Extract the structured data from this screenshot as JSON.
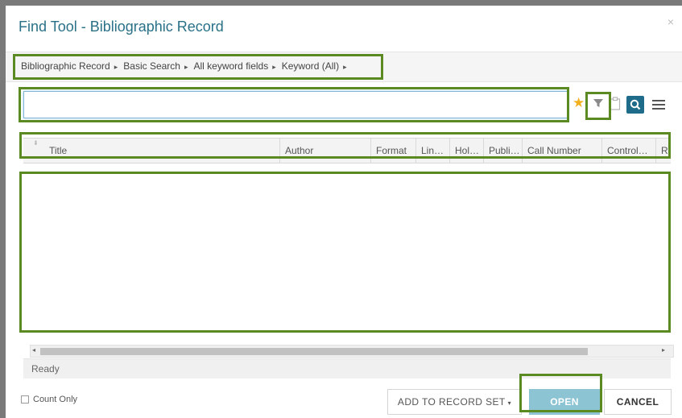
{
  "dialog": {
    "title": "Find Tool - Bibliographic Record",
    "close_glyph": "×"
  },
  "breadcrumb": {
    "items": [
      "Bibliographic Record",
      "Basic Search",
      "All keyword fields",
      "Keyword (All)"
    ],
    "separator": "▸"
  },
  "search": {
    "value": "",
    "placeholder": ""
  },
  "toolbar": {
    "icons": [
      "star-icon",
      "filter-icon",
      "clipboard-icon",
      "search-icon",
      "menu-icon"
    ],
    "star_color": "#f2b01e",
    "search_button_color": "#1f6c8a"
  },
  "grid": {
    "columns": [
      "Title",
      "Author",
      "Format",
      "Lin…",
      "Hol…",
      "Publi…",
      "Call Number",
      "Control…",
      "Re"
    ],
    "rows": []
  },
  "status": {
    "text": "Ready"
  },
  "footer": {
    "count_only_label": "Count Only",
    "count_only_checked": false,
    "add_to_record_set_label": "ADD TO RECORD SET",
    "open_label": "OPEN",
    "cancel_label": "CANCEL"
  },
  "colors": {
    "title": "#2a7187",
    "highlight": "#5b8a23",
    "open_button": "#8cc4d4"
  }
}
